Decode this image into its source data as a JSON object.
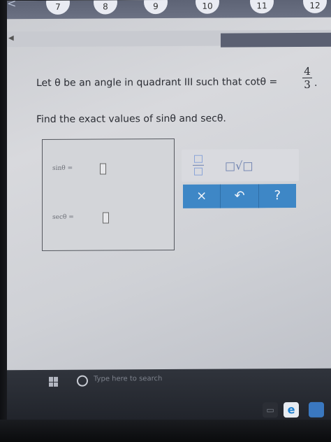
{
  "question_nav": {
    "prev_label": "<",
    "numbers": [
      "7",
      "8",
      "9",
      "10",
      "11",
      "12"
    ]
  },
  "question": {
    "intro": "Let θ be an angle in quadrant III such that cotθ =",
    "fraction": {
      "numerator": "4",
      "denominator": "3"
    },
    "punctuation": ".",
    "instruction": "Find the exact values of sinθ and secθ."
  },
  "answers": {
    "sin_label": "sinθ  =",
    "sec_label": "secθ  ="
  },
  "toolbar": {
    "sqrt_label": "□√□",
    "clear_label": "×",
    "undo_label": "↶",
    "help_label": "?"
  },
  "taskbar": {
    "search_placeholder": "Type here to search",
    "edge_label": "e"
  },
  "colors": {
    "accent_blue": "#3e87c6",
    "nav_bar": "#5d6375"
  }
}
